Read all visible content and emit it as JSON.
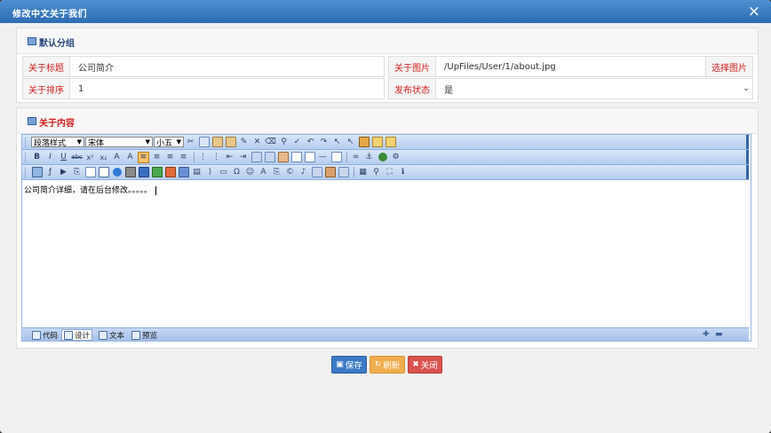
{
  "dialog": {
    "title": "修改中文关于我们",
    "close_glyph": "×"
  },
  "sections": {
    "default_group": "默认分组",
    "about_content": "关于内容"
  },
  "fields": {
    "title_label": "关于标题",
    "title_value": "公司简介",
    "order_label": "关于排序",
    "order_value": "1",
    "image_label": "关于图片",
    "image_value": "/UpFiles/User/1/about.jpg",
    "image_button": "选择图片",
    "status_label": "发布状态",
    "status_value": "是"
  },
  "editor": {
    "selects": {
      "paragraph_style": "段落样式",
      "font": "宋体",
      "size": "小五"
    },
    "toolbar_row2_text": [
      "B",
      "I",
      "U",
      "abc",
      "x²",
      "x₂"
    ],
    "content_text": "公司简介详细，请在后台修改。。。。。",
    "tabs": [
      "代码",
      "设计",
      "文本",
      "预览"
    ],
    "active_tab": "设计"
  },
  "actions": {
    "save": "保存",
    "refresh": "刷新",
    "close": "关闭"
  },
  "colors": {
    "titlebar": "#2d6db3",
    "label_red": "#d12020",
    "save_blue": "#3c7ac6",
    "refresh_orange": "#f0ad4e",
    "close_red": "#d9534f"
  }
}
